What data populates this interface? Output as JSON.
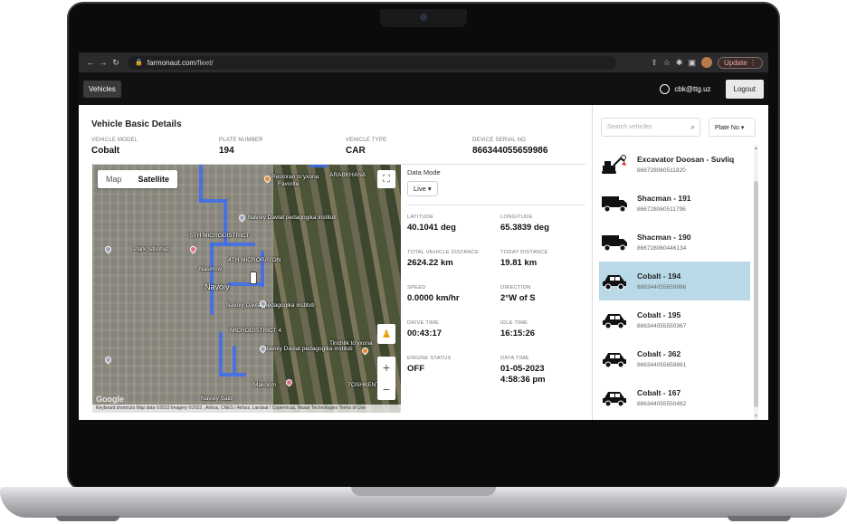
{
  "browser": {
    "url_host": "farmonaut.com",
    "url_path": "/fleet/",
    "update_label": "Update"
  },
  "header": {
    "vehicles_button": "Vehicles",
    "user_email": "cbk@ttg.uz",
    "logout_label": "Logout"
  },
  "details": {
    "title": "Vehicle Basic Details",
    "fields": [
      {
        "label": "VEHICLE MODEL",
        "value": "Cobalt"
      },
      {
        "label": "PLATE NUMBER",
        "value": "194"
      },
      {
        "label": "VEHICLE TYPE",
        "value": "CAR"
      },
      {
        "label": "DEVICE SERIAL NO",
        "value": "866344055659986"
      }
    ]
  },
  "map": {
    "map_tab": "Map",
    "satellite_tab": "Satellite",
    "labels": [
      "Restoran to'yxona",
      "Favorite",
      "ARABKHANA",
      "Navoiy Davlat pedagogika instituti",
      "5TH MICRODISTRICT",
      "Park Istirohat",
      "4TH MICRORAYON",
      "Nasimov",
      "Navoiy",
      "Navoiy Davlat pedagogika instituti",
      "MICRODISTRICT 4",
      "Navoiy Davlat pedagogika instituti",
      "Tinchlik to'yxona",
      "Makorim",
      "Navoiy Said",
      "TOSHKENT"
    ],
    "attribution": "Keyboard shortcuts   Map data ©2023 Imagery ©2023 , Airbus, CNES / Airbus, Landsat / Copernicus, Maxar Technologies   Terms of Use",
    "google": "Google"
  },
  "data_panel": {
    "mode_label": "Data Mode",
    "mode_value": "Live",
    "items": [
      {
        "label": "LATITUDE",
        "value": "40.1041 deg"
      },
      {
        "label": "LONGITUDE",
        "value": "65.3839 deg"
      },
      {
        "label": "TOTAL VEHICLE DISTANCE",
        "value": "2624.22 km"
      },
      {
        "label": "TODAY DISTANCE",
        "value": "19.81 km"
      },
      {
        "label": "SPEED",
        "value": "0.0000 km/hr"
      },
      {
        "label": "DIRECTION",
        "value": "2°W of S"
      },
      {
        "label": "DRIVE TIME",
        "value": "00:43:17"
      },
      {
        "label": "IDLE TIME",
        "value": "16:15:26"
      },
      {
        "label": "ENGINE STATUS",
        "value": "OFF"
      },
      {
        "label": "DATA TIME",
        "value": "01-05-2023"
      },
      {
        "label": "",
        "value": "4:58:36 pm"
      }
    ]
  },
  "sidebar": {
    "search_placeholder": "Search vehicles",
    "sort_label": "Plate No",
    "vehicles": [
      {
        "name": "Excavator Doosan - Suvliq",
        "serial": "866728060511820",
        "icon": "excavator-icon"
      },
      {
        "name": "Shacman - 191",
        "serial": "866728060511796",
        "icon": "truck-icon"
      },
      {
        "name": "Shacman - 190",
        "serial": "866728060446134",
        "icon": "truck-icon"
      },
      {
        "name": "Cobalt - 194",
        "serial": "866344055659986",
        "icon": "car-icon",
        "selected": true
      },
      {
        "name": "Cobalt - 195",
        "serial": "866344055550367",
        "icon": "car-icon"
      },
      {
        "name": "Cobalt - 362",
        "serial": "866344055659861",
        "icon": "car-icon"
      },
      {
        "name": "Cobalt - 167",
        "serial": "866344055550482",
        "icon": "car-icon"
      }
    ]
  },
  "colors": {
    "selected_row": "#b9d9e8",
    "route": "#3b6df0",
    "header_bg": "#111111"
  }
}
